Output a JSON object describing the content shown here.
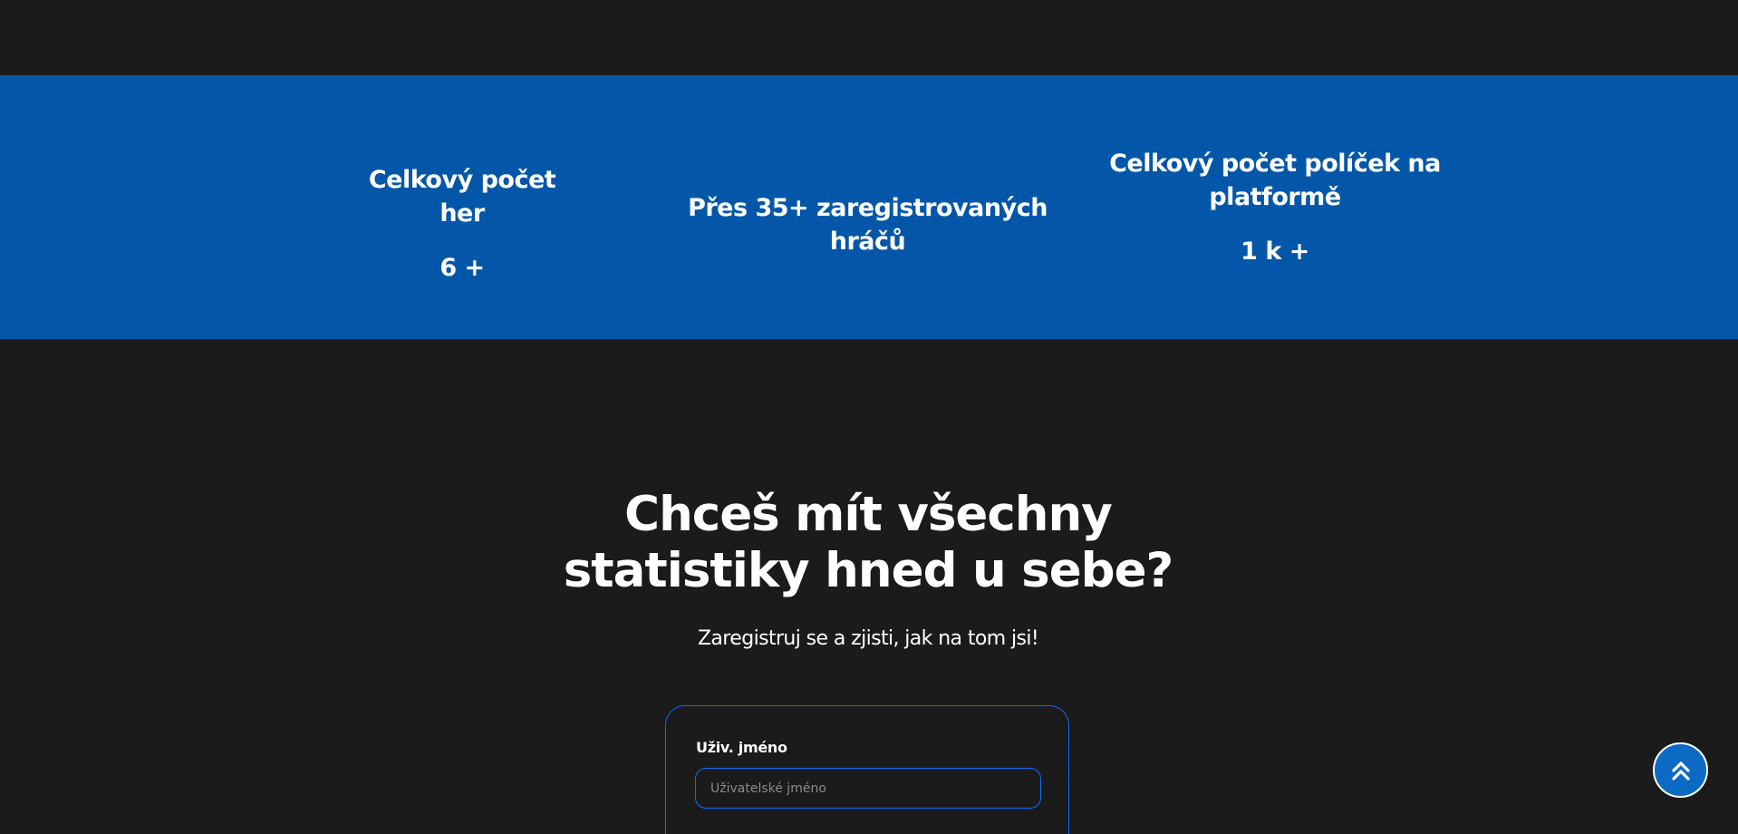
{
  "stats": [
    {
      "title": "Celkový počet her",
      "value": "6 +"
    },
    {
      "title": "Přes 35+ zaregistrovaných hráčů",
      "value": ""
    },
    {
      "title": "Celkový počet políček na platformě",
      "value": "1 k +"
    }
  ],
  "cta": {
    "heading_line1": "Chceš mít všechny",
    "heading_line2": "statistiky hned u sebe?",
    "subtitle": "Zaregistruj se a zjisti, jak na tom jsi!"
  },
  "form": {
    "username_label": "Uživ. jméno",
    "username_placeholder": "Uživatelské jméno",
    "username_value": ""
  },
  "scroll_top": {
    "icon": "double-chevron-up-icon"
  },
  "colors": {
    "background": "#1b1b1b",
    "stats_band": "#0457a8",
    "accent": "#0d6efd",
    "scroll_button": "#0d6ac4"
  }
}
